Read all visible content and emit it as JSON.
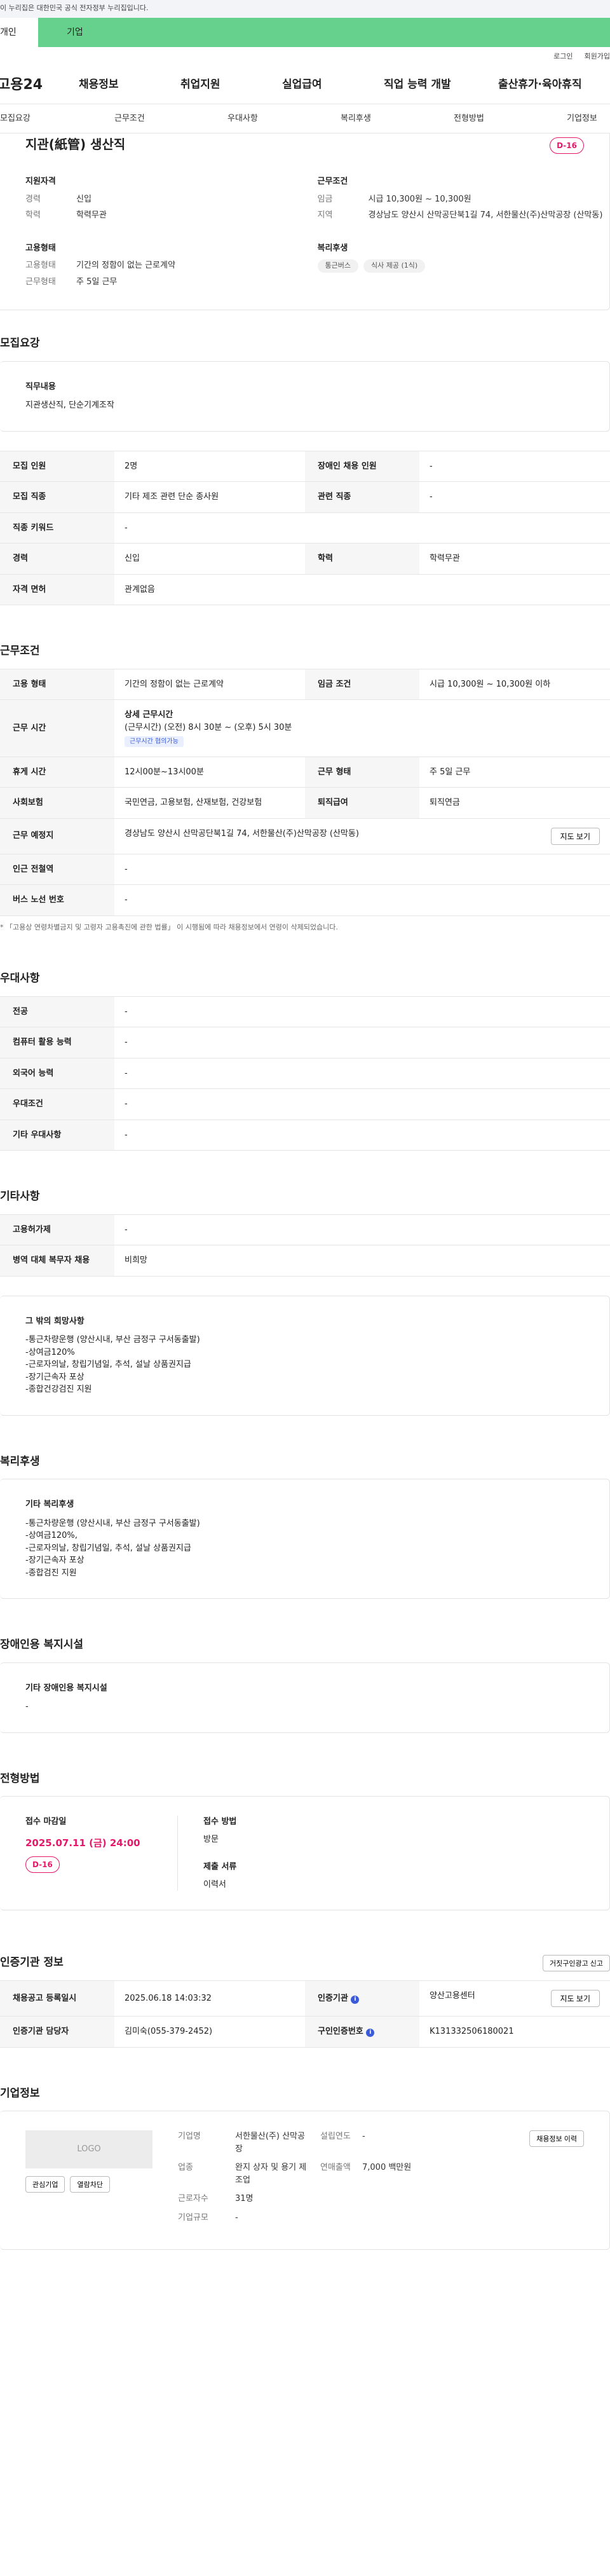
{
  "gov_banner": "이 누리집은 대한민국 공식 전자정부 누리집입니다.",
  "segments": {
    "personal": "개인",
    "company": "기업"
  },
  "util": {
    "login": "로그인",
    "join": "회원가입"
  },
  "logo": "고용24",
  "mainnav": [
    "채용정보",
    "취업지원",
    "실업급여",
    "직업 능력 개발",
    "출산휴가·육아휴직"
  ],
  "subnav": [
    "모집요강",
    "근무조건",
    "우대사항",
    "복리후생",
    "전형방법",
    "기업정보"
  ],
  "summary": {
    "title": "지관(紙管) 생산직",
    "dday": "D-16",
    "apply_label": "지원자격",
    "career_k": "경력",
    "career_v": "신입",
    "edu_k": "학력",
    "edu_v": "학력무관",
    "work_label": "근무조건",
    "wage_k": "임금",
    "wage_v": "시급 10,300원 ~ 10,300원",
    "area_k": "지역",
    "area_v": "경상남도 양산시 산막공단북1길 74, 서한물산(주)산막공장 (산막동)",
    "emp_label": "고용형태",
    "emptype_k": "고용형태",
    "emptype_v": "기간의 정함이 없는 근로계약",
    "hours_k": "근무형태",
    "hours_v": "주 5일 근무",
    "welfare_label": "복리후생",
    "tags": [
      "통근버스",
      "식사 제공 (1식)"
    ]
  },
  "recruit": {
    "heading": "모집요강",
    "duty_label": "직무내용",
    "duty_text": "지관생산직, 단순기계조작",
    "rows": [
      [
        "모집 인원",
        "2명",
        "장애인 채용 인원",
        "-"
      ],
      [
        "모집 직종",
        "기타 제조 관련 단순 종사원",
        "관련 직종",
        "-"
      ],
      [
        "직종 키워드",
        "-",
        "",
        ""
      ],
      [
        "경력",
        "신입",
        "학력",
        "학력무관"
      ],
      [
        "자격 면허",
        "관계없음",
        "",
        ""
      ]
    ]
  },
  "condition": {
    "heading": "근무조건",
    "emp_k": "고용 형태",
    "emp_v": "기간의 정함이 없는 근로계약",
    "wage_k": "임금 조건",
    "wage_v": "시급 10,300원 ~ 10,300원 이하",
    "time_k": "근무 시간",
    "time_title": "상세 근무시간",
    "time_text": "(근무시간) (오전) 8시 30분 ~ (오후) 5시 30분",
    "time_tag": "근무시간 협의가능",
    "rest_k": "휴게 시간",
    "rest_v": "12시00분~13시00분",
    "form_k": "근무 형태",
    "form_v": "주 5일 근무",
    "ins_k": "사회보험",
    "ins_v": "국민연금, 고용보험, 산재보험, 건강보험",
    "sev_k": "퇴직급여",
    "sev_v": "퇴직연금",
    "place_k": "근무 예정지",
    "place_v": "경상남도 양산시 산막공단북1길 74, 서한물산(주)산막공장 (산막동)",
    "map_btn": "지도 보기",
    "subway_k": "인근 전철역",
    "subway_v": "-",
    "bus_k": "버스 노선 번호",
    "bus_v": "-",
    "note": "* 「고용상 연령차별금지 및 고령자 고용촉진에 관한 법률」 이 시행됨에 따라 채용정보에서 연령이 삭제되었습니다."
  },
  "prefer": {
    "heading": "우대사항",
    "rows": [
      [
        "전공",
        "-"
      ],
      [
        "컴퓨터 활용 능력",
        "-"
      ],
      [
        "외국어 능력",
        "-"
      ],
      [
        "우대조건",
        "-"
      ],
      [
        "기타 우대사항",
        "-"
      ]
    ]
  },
  "other": {
    "heading": "기타사항",
    "rows": [
      [
        "고용허가제",
        "-"
      ],
      [
        "병역 대체 복무자 채용",
        "비희망"
      ]
    ],
    "box_title": "그 밖의 희망사항",
    "box_lines": [
      "-통근차량운행 (양산시내, 부산 금정구 구서동출발)",
      "-상여금120%",
      "-근로자의날, 창립기념일, 추석, 설날 상품권지급",
      "-장기근속자 포상",
      "-종합건강검진 지원"
    ]
  },
  "welfare": {
    "heading": "복리후생",
    "box_title": "기타 복리후생",
    "box_lines": [
      "-통근차량운행 (양산시내, 부산 금정구 구서동출발)",
      "-상여금120%,",
      "-근로자의날, 창립기념일, 추석, 설날 상품권지급",
      "-장기근속자 포상",
      "-종합검진 지원"
    ]
  },
  "disabled": {
    "heading": "장애인용 복지시설",
    "box_title": "기타 장애인용 복지시설",
    "box_value": "-"
  },
  "selection": {
    "heading": "전형방법",
    "deadline_label": "접수 마감일",
    "deadline": "2025.07.11 (금) 24:00",
    "dday": "D-16",
    "method_label": "접수 방법",
    "method": "방문",
    "docs_label": "제출 서류",
    "docs": "이력서"
  },
  "agency": {
    "heading": "인증기관 정보",
    "report_btn": "거짓구인광고 신고",
    "reg_k": "채용공고 등록일시",
    "reg_v": "2025.06.18 14:03:32",
    "org_k": "인증기관",
    "org_v": "양산고용센터",
    "map_btn": "지도 보기",
    "mgr_k": "인증기관 담당자",
    "mgr_v": "김미숙(055-379-2452)",
    "num_k": "구인인증번호",
    "num_v": "K131332506180021"
  },
  "company": {
    "heading": "기업정보",
    "logo_text": "LOGO",
    "fav_btn": "관심기업",
    "block_btn": "열람차단",
    "hist_btn": "채용정보 이력",
    "name_k": "기업명",
    "name_v": "서한물산(주) 산막공장",
    "est_k": "설립연도",
    "est_v": "-",
    "biz_k": "업종",
    "biz_v": "완지 상자 및 용기 제조업",
    "sales_k": "연매출액",
    "sales_v": "7,000 백만원",
    "emp_k": "근로자수",
    "emp_v": "31명",
    "size_k": "기업규모",
    "size_v": "-"
  }
}
